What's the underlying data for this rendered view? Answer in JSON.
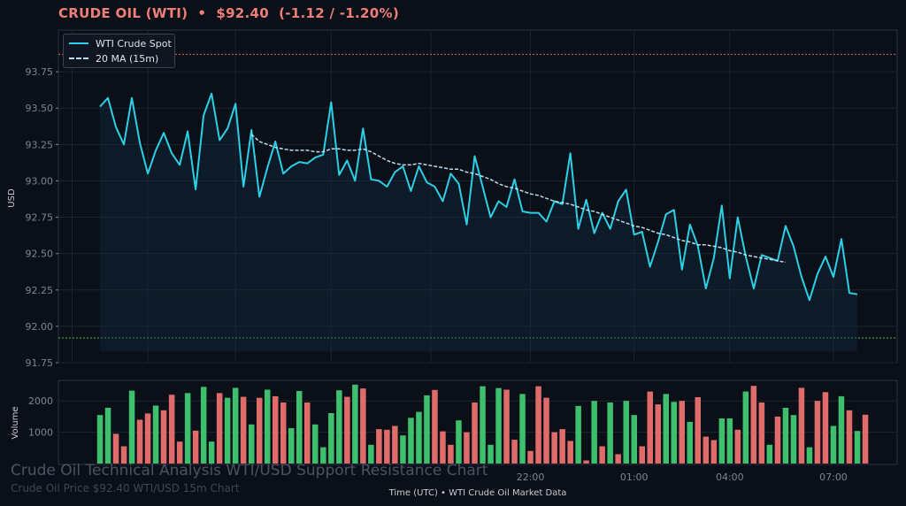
{
  "header": {
    "symbol": "CRUDE OIL (WTI)",
    "separator": "•",
    "price": "$92.40",
    "change": "(-1.12 / -1.20%)"
  },
  "colors": {
    "background": "#0b0f17",
    "price_line": "#2bd0e6",
    "ma_line": "#b7dff0",
    "resistance": "#d9675e",
    "support": "#55b45a",
    "volume_up": "#3dbf6e",
    "volume_down": "#e06b6b"
  },
  "chart_data": [
    {
      "type": "line",
      "title": "",
      "xlabel": "",
      "ylabel": "USD",
      "ylim": [
        91.75,
        94.0
      ],
      "yticks": [
        91.75,
        92.0,
        92.25,
        92.5,
        92.75,
        93.0,
        93.25,
        93.5,
        93.75
      ],
      "ytick_labels": [
        "91.75",
        "92.00",
        "92.25",
        "92.50",
        "92.75",
        "93.00",
        "93.25",
        "93.50",
        "93.75"
      ],
      "grid": true,
      "legend": "top-left",
      "resistance_level": 93.87,
      "support_level": 91.92,
      "series": [
        {
          "name": "WTI Crude Spot",
          "values": [
            93.51,
            93.57,
            93.37,
            93.25,
            93.57,
            93.26,
            93.05,
            93.21,
            93.33,
            93.19,
            93.11,
            93.34,
            92.94,
            93.45,
            93.6,
            93.28,
            93.36,
            93.53,
            92.96,
            93.35,
            92.89,
            93.09,
            93.27,
            93.05,
            93.1,
            93.13,
            93.12,
            93.16,
            93.18,
            93.54,
            93.04,
            93.14,
            93.0,
            93.36,
            93.01,
            93.0,
            92.96,
            93.06,
            93.1,
            92.93,
            93.1,
            92.99,
            92.96,
            92.86,
            93.05,
            92.98,
            92.7,
            93.17,
            92.96,
            92.75,
            92.86,
            92.82,
            93.01,
            92.79,
            92.78,
            92.78,
            92.72,
            92.86,
            92.84,
            93.19,
            92.67,
            92.87,
            92.64,
            92.78,
            92.67,
            92.86,
            92.94,
            92.63,
            92.65,
            92.41,
            92.58,
            92.77,
            92.8,
            92.39,
            92.7,
            92.55,
            92.26,
            92.47,
            92.83,
            92.33,
            92.75,
            92.48,
            92.26,
            92.49,
            92.47,
            92.45,
            92.69,
            92.55,
            92.34,
            92.18,
            92.36,
            92.48,
            92.34,
            92.6,
            92.23,
            92.22
          ]
        },
        {
          "name": "20 MA (15m)",
          "start_index": 19,
          "values": [
            93.32,
            93.27,
            93.25,
            93.23,
            93.22,
            93.21,
            93.21,
            93.21,
            93.2,
            93.2,
            93.22,
            93.22,
            93.21,
            93.21,
            93.22,
            93.2,
            93.17,
            93.14,
            93.12,
            93.11,
            93.11,
            93.12,
            93.11,
            93.1,
            93.09,
            93.08,
            93.08,
            93.06,
            93.05,
            93.03,
            93.01,
            92.98,
            92.96,
            92.95,
            92.93,
            92.91,
            92.9,
            92.88,
            92.86,
            92.85,
            92.84,
            92.82,
            92.8,
            92.79,
            92.77,
            92.75,
            92.73,
            92.71,
            92.69,
            92.68,
            92.66,
            92.64,
            92.63,
            92.61,
            92.59,
            92.58,
            92.56,
            92.56,
            92.55,
            92.54,
            92.52,
            92.51,
            92.49,
            92.48,
            92.47,
            92.46,
            92.45,
            92.44
          ]
        }
      ],
      "x_ticks": [
        {
          "label": "22:00",
          "index": 54
        },
        {
          "label": "01:00",
          "index": 67
        },
        {
          "label": "04:00",
          "index": 79
        },
        {
          "label": "07:00",
          "index": 92
        }
      ]
    },
    {
      "type": "bar",
      "title": "",
      "xlabel": "Time (UTC)  •  WTI Crude Oil Market Data",
      "ylabel": "Volume",
      "ylim": [
        0,
        2600
      ],
      "yticks": [
        1000,
        2000
      ],
      "ytick_labels": [
        "1000",
        "2000"
      ],
      "grid": true,
      "series": [
        {
          "name": "Volume",
          "values": [
            1550,
            1780,
            950,
            550,
            2330,
            1400,
            1600,
            1850,
            1700,
            2200,
            700,
            2250,
            1050,
            2450,
            700,
            2250,
            2100,
            2420,
            2130,
            1250,
            2100,
            2360,
            2150,
            1950,
            1130,
            2320,
            1950,
            1250,
            520,
            1610,
            2340,
            2130,
            2520,
            2400,
            600,
            1100,
            1080,
            1200,
            900,
            1460,
            1650,
            2180,
            2350,
            1030,
            600,
            1380,
            1000,
            1950,
            2470,
            600,
            2410,
            2360,
            760,
            2220,
            400,
            2470,
            2100,
            1000,
            1100,
            720,
            1840,
            100,
            2000,
            550,
            1950,
            300,
            2000,
            1550,
            550,
            2300,
            1890,
            2220,
            1970,
            2000,
            1330,
            2120,
            860,
            750,
            1440,
            1440,
            1080,
            2300,
            2480,
            1950,
            600,
            1500,
            1780,
            1550,
            2420,
            520,
            2000,
            2280,
            1200,
            2150,
            1700,
            1040,
            1560
          ]
        }
      ],
      "bar_direction": [
        1,
        1,
        0,
        0,
        1,
        0,
        0,
        1,
        0,
        0,
        0,
        1,
        0,
        1,
        1,
        0,
        1,
        1,
        0,
        1,
        0,
        1,
        0,
        0,
        1,
        1,
        0,
        1,
        1,
        1,
        1,
        0,
        1,
        0,
        1,
        0,
        0,
        0,
        1,
        1,
        1,
        1,
        0,
        0,
        0,
        1,
        0,
        0,
        1,
        1,
        1,
        0,
        0,
        1,
        0,
        0,
        0,
        0,
        0,
        0,
        1,
        0,
        1,
        0,
        1,
        0,
        1,
        1,
        0,
        0,
        0,
        1,
        1,
        0,
        1,
        0,
        0,
        0,
        1,
        1,
        0,
        1,
        0,
        0,
        1,
        0,
        1,
        1,
        0,
        1,
        0,
        0,
        1,
        1,
        0,
        1
      ]
    }
  ],
  "watermark": {
    "title": "Crude Oil Technical Analysis WTI/USD Support Resistance Chart",
    "subtitle": "Crude Oil Price $92.40 WTI/USD 15m Chart"
  }
}
